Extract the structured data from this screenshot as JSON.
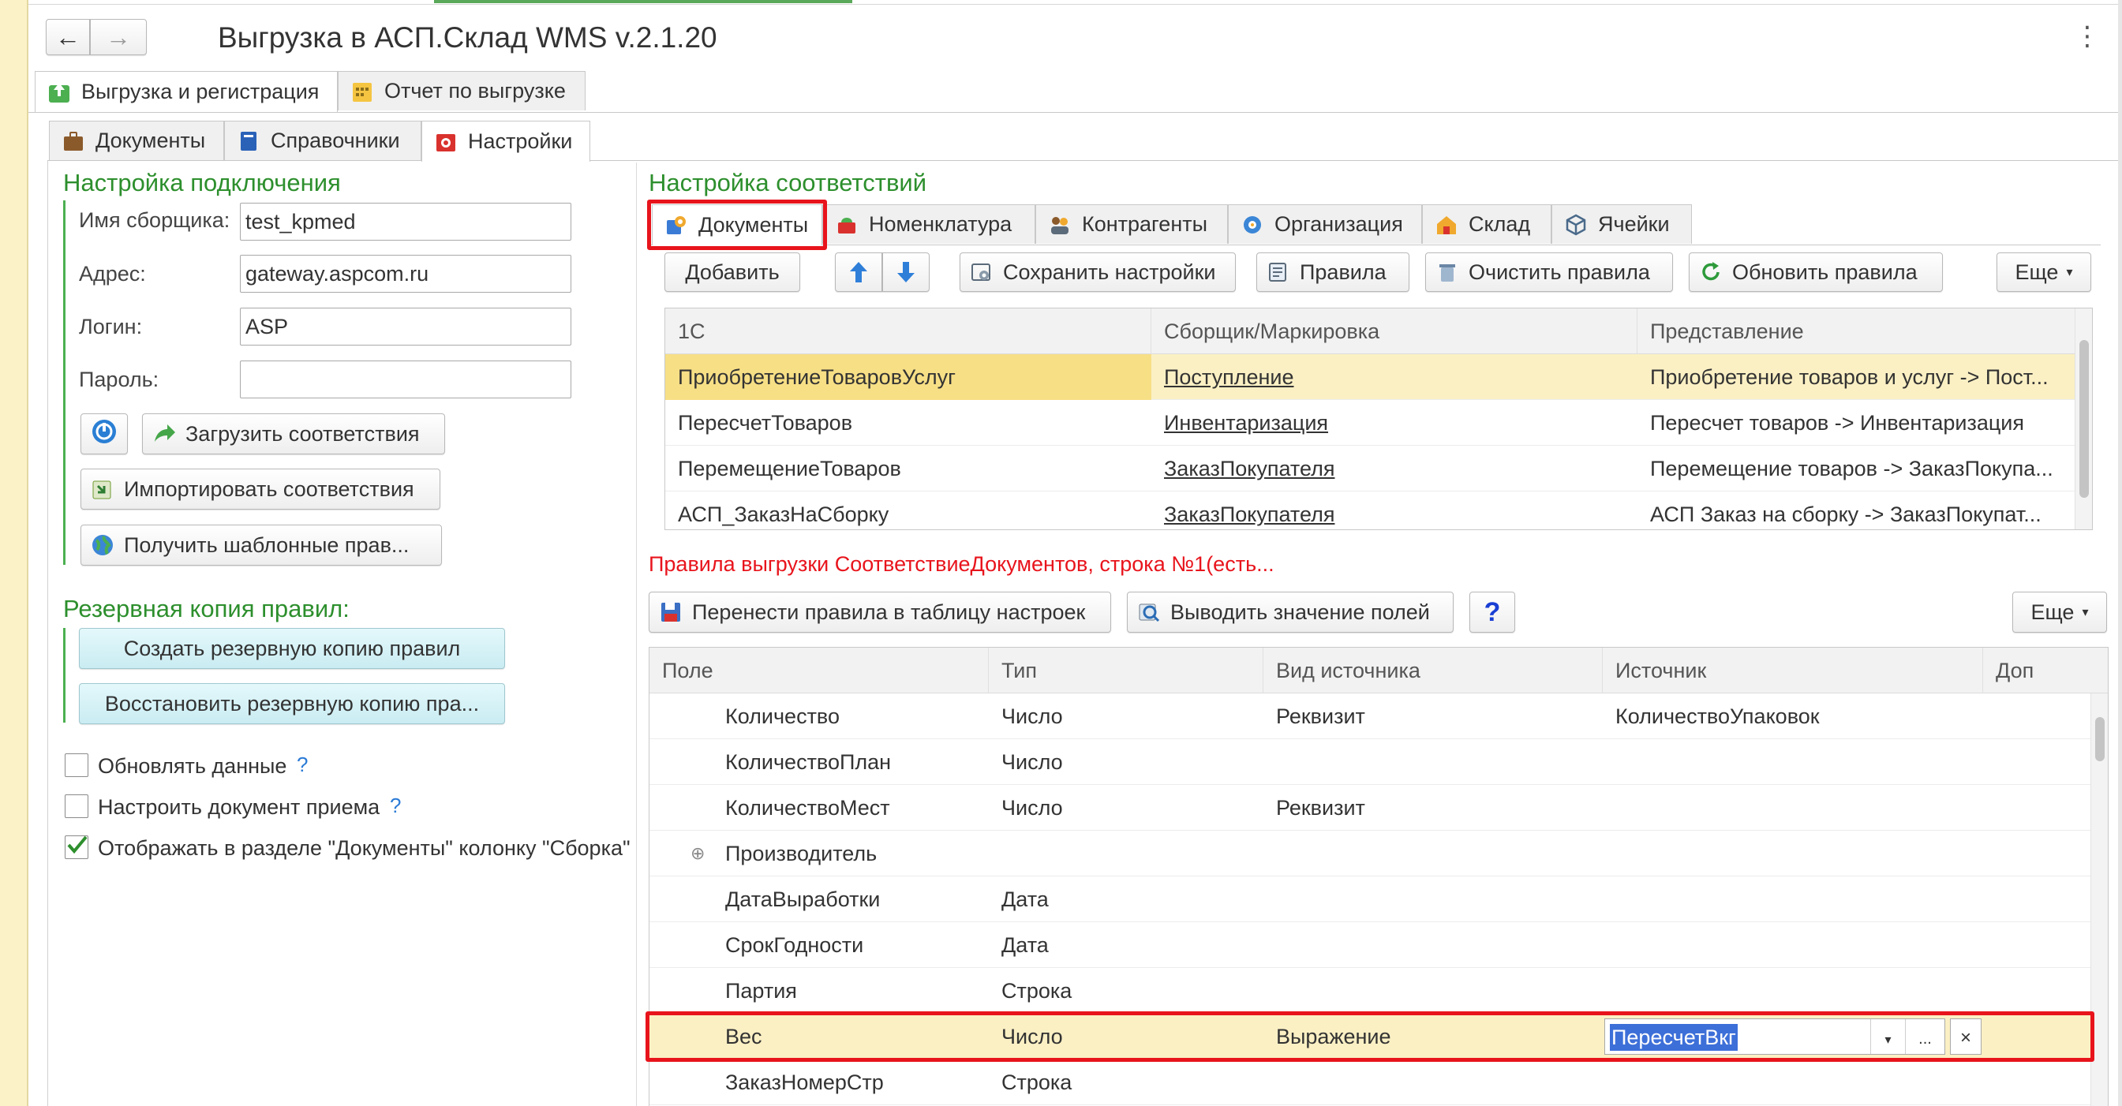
{
  "window": {
    "title": "Выгрузка в АСП.Склад WMS v.2.1.20",
    "nav_back": "←",
    "nav_forward": "→",
    "menu": "⋮"
  },
  "top_tabs": [
    {
      "label": "Выгрузка и регистрация",
      "icon": "export-icon"
    },
    {
      "label": "Отчет по выгрузке",
      "icon": "report-icon"
    }
  ],
  "sub_tabs": [
    {
      "label": "Документы",
      "icon": "briefcase-icon"
    },
    {
      "label": "Справочники",
      "icon": "book-icon"
    },
    {
      "label": "Настройки",
      "icon": "settings-icon"
    }
  ],
  "connection": {
    "title": "Настройка подключения",
    "picker_label": "Имя сборщика:",
    "picker_value": "test_kpmed",
    "address_label": "Адрес:",
    "address_value": "gateway.aspcom.ru",
    "login_label": "Логин:",
    "login_value": "ASP",
    "password_label": "Пароль:",
    "password_value": "",
    "load_button": "Загрузить соответствия",
    "import_button": "Импортировать соответствия",
    "templates_button": "Получить шаблонные прав..."
  },
  "backup": {
    "title": "Резервная копия правил:",
    "create_button": "Создать резервную копию правил",
    "restore_button": "Восстановить резервную копию пра..."
  },
  "options": [
    {
      "label": "Обновлять данные",
      "checked": false,
      "help": "?"
    },
    {
      "label": "Настроить документ приема",
      "checked": false,
      "help": "?"
    },
    {
      "label": "Отображать в разделе \"Документы\" колонку \"Сборка\"",
      "checked": true,
      "help": ""
    }
  ],
  "mapping": {
    "title": "Настройка соответствий",
    "tabs": [
      {
        "label": "Документы",
        "icon": "documents-icon"
      },
      {
        "label": "Номенклатура",
        "icon": "goods-icon"
      },
      {
        "label": "Контрагенты",
        "icon": "partners-icon"
      },
      {
        "label": "Организация",
        "icon": "organization-icon"
      },
      {
        "label": "Склад",
        "icon": "warehouse-icon"
      },
      {
        "label": "Ячейки",
        "icon": "cells-icon"
      }
    ],
    "toolbar": {
      "add": "Добавить",
      "up": "↑",
      "down": "↓",
      "save": "Сохранить настройки",
      "rules": "Правила",
      "clear": "Очистить правила",
      "refresh": "Обновить правила",
      "more": "Еще"
    },
    "columns": [
      "1С",
      "Сборщик/Маркировка",
      "Представление"
    ],
    "rows": [
      [
        "ПриобретениеТоваровУслуг",
        "Поступление",
        "Приобретение товаров и услуг -> Пост..."
      ],
      [
        "ПересчетТоваров",
        "Инвентаризация",
        "Пересчет товаров -> Инвентаризация"
      ],
      [
        "ПеремещениеТоваров",
        "ЗаказПокупателя",
        "Перемещение товаров -> ЗаказПокупа..."
      ],
      [
        "АСП_ЗаказНаСборку",
        "ЗаказПокупателя",
        "АСП Заказ на сборку -> ЗаказПокупат..."
      ]
    ]
  },
  "rules": {
    "caption": "Правила выгрузки СоответствиеДокументов, строка №1(есть...",
    "transfer_button": "Перенести правила в таблицу настроек",
    "show_values_button": "Выводить значение полей",
    "help_button": "?",
    "more": "Еще",
    "columns": [
      "Поле",
      "Тип",
      "Вид источника",
      "Источник",
      "Доп"
    ],
    "rows": [
      {
        "field": "Количество",
        "type": "Число",
        "kind": "Реквизит",
        "source": "КоличествоУпаковок",
        "expand": ""
      },
      {
        "field": "КоличествоПлан",
        "type": "Число",
        "kind": "",
        "source": "",
        "expand": ""
      },
      {
        "field": "КоличествоМест",
        "type": "Число",
        "kind": "Реквизит",
        "source": "",
        "expand": ""
      },
      {
        "field": "Производитель",
        "type": "",
        "kind": "",
        "source": "",
        "expand": "⊕"
      },
      {
        "field": "ДатаВыработки",
        "type": "Дата",
        "kind": "",
        "source": "",
        "expand": ""
      },
      {
        "field": "СрокГодности",
        "type": "Дата",
        "kind": "",
        "source": "",
        "expand": ""
      },
      {
        "field": "Партия",
        "type": "Строка",
        "kind": "",
        "source": "",
        "expand": ""
      },
      {
        "field": "Вес",
        "type": "Число",
        "kind": "Выражение",
        "source": "ПересчетВкг",
        "expand": ""
      },
      {
        "field": "ЗаказНомерСтр",
        "type": "Строка",
        "kind": "",
        "source": "",
        "expand": ""
      }
    ],
    "editor_dropdown": "▾",
    "editor_ellipsis": "...",
    "editor_clear": "×"
  },
  "colors": {
    "green_title": "#2d8f2d",
    "selected_row": "#fbf0c4",
    "highlight": "#e8141c",
    "caption_red": "#e8141c"
  }
}
